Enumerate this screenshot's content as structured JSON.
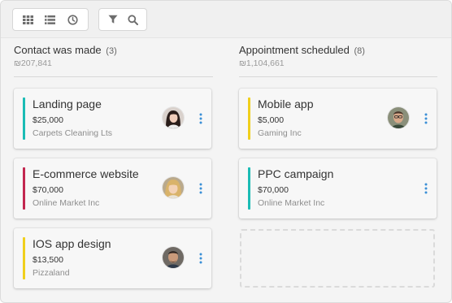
{
  "toolbar": {
    "view_icons": [
      "grid-icon",
      "list-icon",
      "clock-icon"
    ],
    "filter_icons": [
      "filter-icon",
      "search-icon"
    ]
  },
  "columns": [
    {
      "title": "Contact was made",
      "count": "(3)",
      "total": "₪207,841",
      "cards": [
        {
          "title": "Landing page",
          "amount": "$25,000",
          "company": "Carpets Cleaning Lts",
          "color": "#1bbcb5"
        },
        {
          "title": "E-commerce website",
          "amount": "$70,000",
          "company": "Online Market Inc",
          "color": "#c2274f"
        },
        {
          "title": "IOS app design",
          "amount": "$13,500",
          "company": "Pizzaland",
          "color": "#f0cf1c"
        }
      ]
    },
    {
      "title": "Appointment scheduled",
      "count": "(8)",
      "total": "₪1,104,661",
      "cards": [
        {
          "title": "Mobile app",
          "amount": "$5,000",
          "company": "Gaming Inc",
          "color": "#f0cf1c"
        },
        {
          "title": "PPC campaign",
          "amount": "$70,000",
          "company": "Online Market Inc",
          "color": "#1bbcb5"
        }
      ]
    }
  ],
  "colors": {
    "accent": "#3a8fd6",
    "icon": "#6d6d6d"
  }
}
